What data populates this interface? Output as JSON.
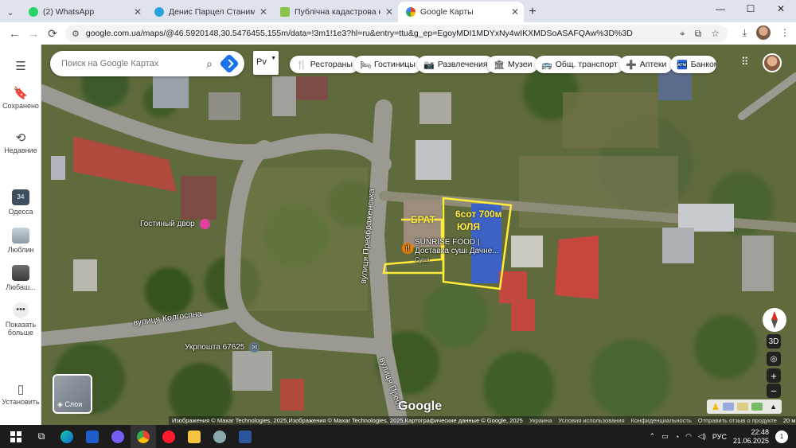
{
  "browser": {
    "tabs": [
      {
        "title": "(2) WhatsApp",
        "color": "#25d366",
        "active": false
      },
      {
        "title": "Денис Парцел Станимак",
        "color": "#2aa3e0",
        "active": false
      },
      {
        "title": "Публічна кадастрова карта Украї",
        "color": "#8bc34a",
        "active": false
      },
      {
        "title": "Google Карты",
        "color": "#34a853",
        "active": true
      }
    ],
    "url": "google.com.ua/maps/@46.5920148,30.5476455,155m/data=!3m1!1e3?hl=ru&entry=ttu&g_ep=EgoyMDI1MDYxNy4wIKXMDSoASAFQAw%3D%3D"
  },
  "sidebar": {
    "menu_icon": "menu-icon",
    "items": [
      {
        "label": "Сохранено",
        "icon": "bookmark-icon"
      },
      {
        "label": "Недавние",
        "icon": "history-icon"
      },
      {
        "label": "Одесса",
        "icon": "place-thumb"
      },
      {
        "label": "Люблин",
        "icon": "place-thumb"
      },
      {
        "label": "Любаш...",
        "icon": "place-thumb"
      },
      {
        "label": "Показать больше",
        "icon": "more-icon"
      },
      {
        "label": "Установить",
        "icon": "install-icon"
      }
    ],
    "badge_odessa": "34"
  },
  "search": {
    "placeholder": "Поиск на Google Картах"
  },
  "lang": "Рv",
  "chips": [
    {
      "label": "Рестораны",
      "icon": "🍴"
    },
    {
      "label": "Гостиницы",
      "icon": "🛏"
    },
    {
      "label": "Развлечения",
      "icon": "📷"
    },
    {
      "label": "Музеи",
      "icon": "🏛"
    },
    {
      "label": "Общ. транспорт",
      "icon": "🚌"
    },
    {
      "label": "Аптеки",
      "icon": "➕"
    },
    {
      "label": "Банкома",
      "icon": "🏧"
    }
  ],
  "map": {
    "roads": {
      "preobrazhenska": "вулиця Преображенська",
      "kolgospna": "вулиця Колгоспна",
      "preobr_bottom": "вулиця Преоб"
    },
    "pois": {
      "dvor": "Гостиный двор",
      "ukrposhta": "Укрпошта 67625",
      "sunrise1": "SUNRISE FOOD |",
      "sunrise2": "Доставка суші Дачне...",
      "sunrise3": "Суші"
    },
    "plot_labels": {
      "brat": "БРАТ",
      "size": "6сот 700м",
      "name": "ЮЛЯ"
    },
    "plot_color": "#ffeb3b"
  },
  "controls": {
    "three_d": "3D",
    "zoom_in": "+",
    "zoom_out": "−",
    "layers": "Слои"
  },
  "footer": {
    "imagery": "Изображения © Maxar Technologies, 2025,Изображения © Maxar Technologies, 2025,Картографические данные © Google, 2025",
    "country": "Украина",
    "terms": "Условия использования",
    "privacy": "Конфиденциальность",
    "feedback": "Отправить отзыв о продукте",
    "scale": "20 м"
  },
  "google_logo": "Google",
  "taskbar": {
    "lang": "РУС",
    "time": "22:48",
    "date": "21.06.2025",
    "notif": "1"
  }
}
